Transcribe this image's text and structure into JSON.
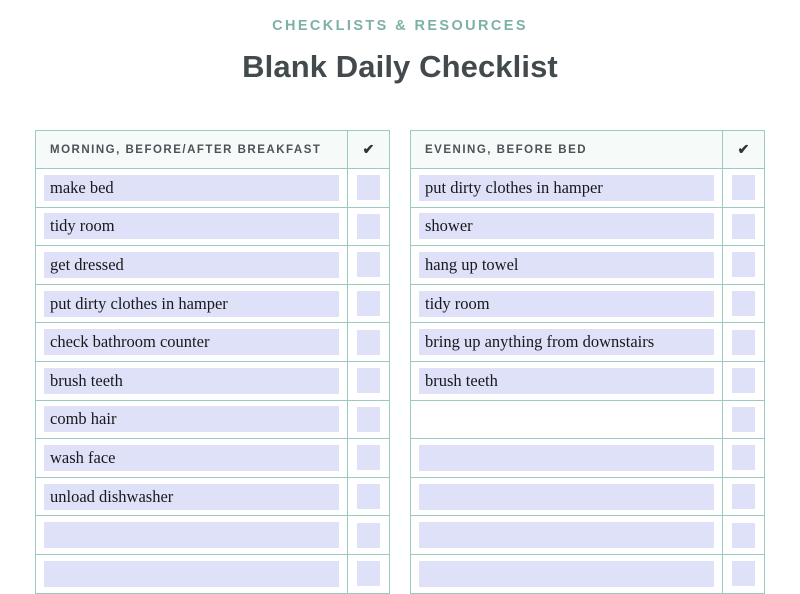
{
  "header": {
    "eyebrow": "CHECKLISTS & RESOURCES",
    "title": "Blank Daily Checklist"
  },
  "colors": {
    "accent_teal": "#7db0a7",
    "table_border": "#9cc9c0",
    "field_lavender": "#dfe1f8",
    "header_bg": "#f6fbfa",
    "title_text": "#434a4d"
  },
  "tables": [
    {
      "id": "morning",
      "header": "MORNING, BEFORE/AFTER BREAKFAST",
      "check_header_icon": "✔",
      "rows": [
        {
          "task": "make bed",
          "field_blank": false,
          "checked": false
        },
        {
          "task": "tidy room",
          "field_blank": false,
          "checked": false
        },
        {
          "task": "get dressed",
          "field_blank": false,
          "checked": false
        },
        {
          "task": "put dirty clothes in hamper",
          "field_blank": false,
          "checked": false
        },
        {
          "task": "check bathroom counter",
          "field_blank": false,
          "checked": false
        },
        {
          "task": "brush teeth",
          "field_blank": false,
          "checked": false
        },
        {
          "task": "comb hair",
          "field_blank": false,
          "checked": false
        },
        {
          "task": "wash face",
          "field_blank": false,
          "checked": false
        },
        {
          "task": "unload dishwasher",
          "field_blank": false,
          "checked": false
        },
        {
          "task": "",
          "field_blank": false,
          "checked": false
        },
        {
          "task": "",
          "field_blank": false,
          "checked": false
        }
      ]
    },
    {
      "id": "evening",
      "header": "EVENING, BEFORE BED",
      "check_header_icon": "✔",
      "rows": [
        {
          "task": "put dirty clothes in hamper",
          "field_blank": false,
          "checked": false
        },
        {
          "task": "shower",
          "field_blank": false,
          "checked": false
        },
        {
          "task": "hang up towel",
          "field_blank": false,
          "checked": false
        },
        {
          "task": "tidy room",
          "field_blank": false,
          "checked": false
        },
        {
          "task": "bring up anything from downstairs",
          "field_blank": false,
          "checked": false
        },
        {
          "task": "brush teeth",
          "field_blank": false,
          "checked": false
        },
        {
          "task": "",
          "field_blank": true,
          "checked": false
        },
        {
          "task": "",
          "field_blank": false,
          "checked": false
        },
        {
          "task": "",
          "field_blank": false,
          "checked": false
        },
        {
          "task": "",
          "field_blank": false,
          "checked": false
        },
        {
          "task": "",
          "field_blank": false,
          "checked": false
        }
      ]
    }
  ]
}
